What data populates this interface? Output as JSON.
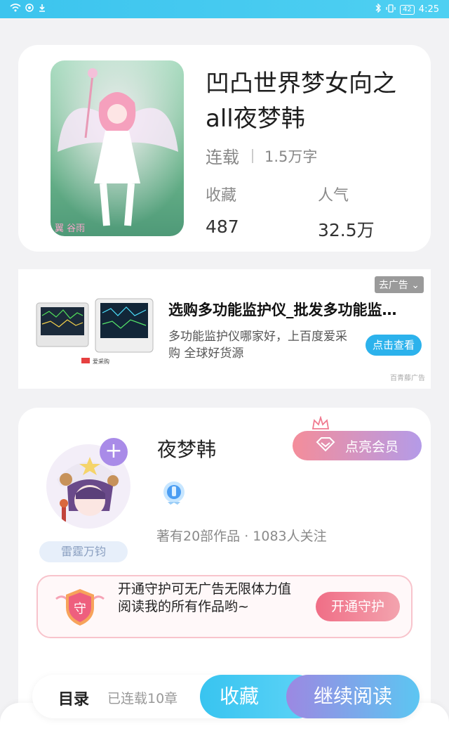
{
  "status_bar": {
    "battery": "42",
    "time": "4:25"
  },
  "book": {
    "title": "凹凸世界梦女向之all夜梦韩",
    "status": "连载",
    "words": "1.5万字",
    "collect_label": "收藏",
    "collect_value": "487",
    "popularity_label": "人气",
    "popularity_value": "32.5万",
    "cover_caption": "翼 谷雨"
  },
  "ad": {
    "close_label": "去广告",
    "title": "选购多功能监护仪_批发多功能监护仪",
    "description": "多功能监护仪哪家好，上百度爱采购 全球好货源",
    "button": "点击查看",
    "source": "百青藤广告",
    "brand": "爱采购"
  },
  "author": {
    "name": "夜梦韩",
    "follow_symbol": "+",
    "tag": "雷霆万钧",
    "stats": "著有20部作品 · 1083人关注",
    "vip_button": "点亮会员",
    "guard_text": "开通守护可无广告无限体力值阅读我的所有作品哟~",
    "guard_shield_char": "守",
    "guard_button": "开通守护"
  },
  "bottom": {
    "toc": "目录",
    "chapters": "已连载10章",
    "collect": "收藏",
    "read": "继续阅读"
  },
  "colors": {
    "accent_blue": "#3cc4ee",
    "vip_gradient_start": "#f48d9a",
    "vip_gradient_end": "#b49be8",
    "guard_pink": "#f06e86"
  }
}
